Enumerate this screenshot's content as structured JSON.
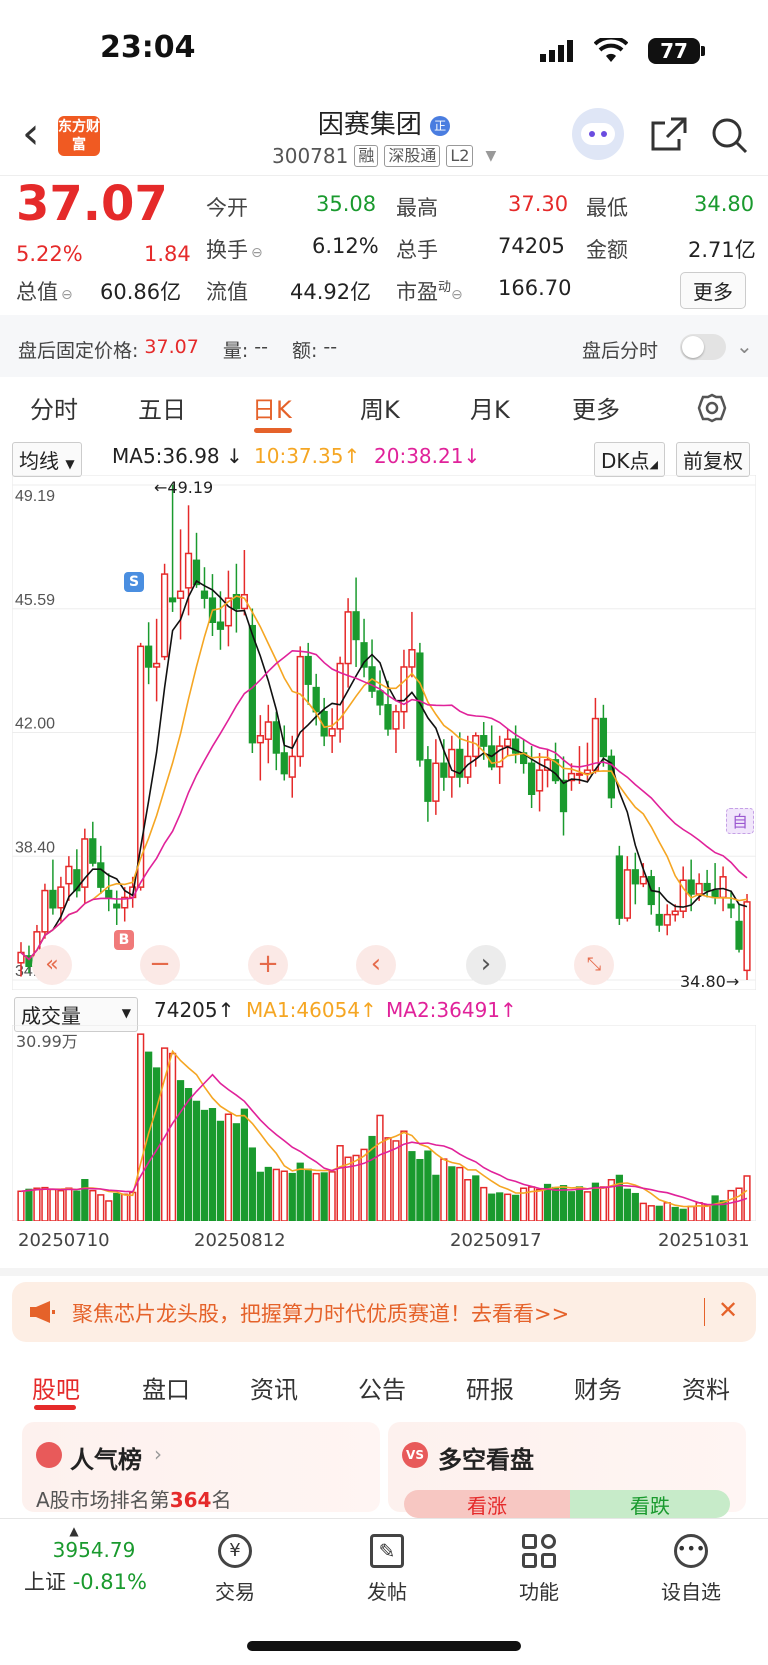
{
  "status": {
    "time": "23:04",
    "battery": "77"
  },
  "header": {
    "logo": "东方财富",
    "stock_name": "因赛集团",
    "code": "300781",
    "tags": [
      "融",
      "深股通",
      "L2"
    ]
  },
  "quote": {
    "price": "37.07",
    "change_pct": "5.22%",
    "change": "1.84",
    "fields": [
      {
        "label": "今开",
        "value": "35.08"
      },
      {
        "label": "最高",
        "value": "37.30"
      },
      {
        "label": "最低",
        "value": "34.80"
      },
      {
        "label": "换手",
        "value": "6.12%"
      },
      {
        "label": "总手",
        "value": "74205"
      },
      {
        "label": "金额",
        "value": "2.71亿"
      },
      {
        "label": "总值",
        "value": "60.86亿"
      },
      {
        "label": "流值",
        "value": "44.92亿"
      },
      {
        "label": "市盈",
        "value": "166.70"
      }
    ],
    "more": "更多"
  },
  "after_hours": {
    "label": "盘后固定价格:",
    "price": "37.07",
    "qty_label": "量:",
    "qty": "--",
    "amt_label": "额:",
    "amt": "--",
    "toggle_label": "盘后分时"
  },
  "period_tabs": [
    "分时",
    "五日",
    "日K",
    "周K",
    "月K",
    "更多"
  ],
  "ma_bar": {
    "selector": "均线",
    "ma5": "MA5:36.98",
    "ma10": "10:37.35",
    "ma20": "20:38.21",
    "dk": "DK点",
    "adjust": "前复权"
  },
  "chart_data": [
    {
      "type": "candlestick",
      "y_ticks": [
        "49.19",
        "45.59",
        "42.00",
        "38.40",
        "34.80"
      ],
      "ylim": [
        34.8,
        49.19
      ],
      "high_label": "49.19",
      "low_label": "34.80",
      "markers": [
        "S",
        "B",
        "自"
      ],
      "x_ticks": [
        "20250710",
        "20250812",
        "20250917",
        "20251031"
      ],
      "series": [
        {
          "name": "MA5",
          "color": "#111111"
        },
        {
          "name": "MA10",
          "color": "#f5a623"
        },
        {
          "name": "MA20",
          "color": "#e0229a"
        }
      ],
      "candles": [
        [
          35.3,
          35.9,
          34.9,
          35.6
        ],
        [
          35.5,
          35.8,
          35.0,
          35.2
        ],
        [
          35.2,
          36.4,
          35.0,
          36.2
        ],
        [
          36.2,
          37.6,
          36.0,
          37.4
        ],
        [
          37.4,
          38.3,
          36.7,
          36.9
        ],
        [
          36.9,
          37.8,
          36.5,
          37.5
        ],
        [
          37.6,
          38.4,
          37.1,
          38.1
        ],
        [
          38.0,
          38.6,
          37.2,
          37.4
        ],
        [
          37.5,
          39.2,
          37.0,
          38.9
        ],
        [
          38.9,
          39.4,
          38.1,
          38.2
        ],
        [
          38.2,
          38.7,
          37.3,
          37.5
        ],
        [
          37.4,
          37.9,
          36.8,
          37.2
        ],
        [
          37.0,
          37.4,
          36.4,
          36.9
        ],
        [
          36.9,
          37.5,
          36.5,
          37.2
        ],
        [
          37.2,
          37.8,
          36.9,
          37.5
        ],
        [
          37.5,
          44.6,
          37.4,
          44.5
        ],
        [
          44.5,
          45.2,
          43.4,
          43.9
        ],
        [
          43.9,
          45.3,
          42.9,
          44.0
        ],
        [
          44.2,
          46.9,
          44.1,
          46.6
        ],
        [
          45.9,
          49.2,
          45.5,
          45.8
        ],
        [
          45.9,
          47.9,
          44.7,
          46.1
        ],
        [
          46.2,
          48.6,
          45.4,
          47.2
        ],
        [
          47.0,
          47.8,
          46.2,
          46.3
        ],
        [
          46.1,
          46.8,
          45.6,
          45.9
        ],
        [
          45.9,
          46.6,
          44.8,
          45.2
        ],
        [
          45.2,
          46.1,
          44.4,
          45.0
        ],
        [
          45.1,
          46.7,
          44.5,
          45.9
        ],
        [
          46.0,
          46.9,
          44.9,
          45.6
        ],
        [
          45.6,
          47.3,
          45.4,
          46.0
        ],
        [
          45.1,
          45.6,
          41.4,
          41.7
        ],
        [
          41.7,
          42.5,
          40.6,
          41.9
        ],
        [
          41.8,
          42.8,
          41.1,
          42.3
        ],
        [
          42.3,
          42.6,
          40.9,
          41.4
        ],
        [
          41.4,
          42.2,
          40.6,
          40.8
        ],
        [
          40.7,
          41.9,
          40.1,
          41.3
        ],
        [
          41.3,
          44.5,
          41.0,
          44.2
        ],
        [
          44.2,
          44.6,
          42.8,
          43.4
        ],
        [
          43.3,
          43.7,
          42.2,
          42.6
        ],
        [
          42.6,
          43.0,
          41.6,
          41.9
        ],
        [
          41.9,
          42.7,
          41.4,
          42.1
        ],
        [
          42.1,
          44.2,
          41.7,
          44.0
        ],
        [
          44.0,
          45.9,
          43.3,
          45.5
        ],
        [
          45.5,
          46.5,
          43.9,
          44.7
        ],
        [
          44.6,
          45.3,
          43.6,
          43.9
        ],
        [
          43.9,
          44.7,
          43.0,
          43.2
        ],
        [
          43.2,
          43.8,
          42.5,
          42.8
        ],
        [
          42.8,
          43.5,
          41.9,
          42.1
        ],
        [
          42.1,
          42.8,
          41.4,
          42.6
        ],
        [
          42.6,
          44.4,
          42.1,
          43.9
        ],
        [
          43.9,
          45.5,
          43.6,
          44.4
        ],
        [
          44.3,
          44.6,
          41.0,
          41.2
        ],
        [
          41.2,
          41.6,
          39.4,
          40.0
        ],
        [
          40.0,
          41.8,
          39.6,
          41.1
        ],
        [
          41.1,
          41.8,
          40.3,
          40.7
        ],
        [
          40.7,
          41.9,
          40.1,
          41.5
        ],
        [
          41.5,
          42.0,
          40.4,
          40.7
        ],
        [
          40.7,
          41.9,
          40.5,
          41.3
        ],
        [
          41.3,
          42.0,
          41.0,
          41.9
        ],
        [
          41.9,
          42.3,
          41.2,
          41.6
        ],
        [
          41.6,
          42.2,
          40.9,
          41.0
        ],
        [
          41.0,
          41.9,
          40.5,
          41.6
        ],
        [
          41.6,
          42.1,
          41.3,
          41.8
        ],
        [
          41.8,
          42.2,
          41.1,
          41.4
        ],
        [
          41.4,
          41.8,
          40.8,
          41.1
        ],
        [
          41.1,
          41.6,
          39.8,
          40.2
        ],
        [
          40.3,
          41.4,
          39.7,
          40.9
        ],
        [
          40.9,
          41.5,
          40.4,
          41.2
        ],
        [
          41.2,
          41.7,
          40.5,
          40.6
        ],
        [
          40.6,
          41.3,
          39.0,
          39.7
        ],
        [
          40.6,
          41.1,
          40.3,
          40.8
        ],
        [
          40.8,
          41.6,
          40.5,
          40.8
        ],
        [
          40.8,
          41.7,
          40.6,
          40.9
        ],
        [
          40.9,
          43.0,
          40.8,
          42.4
        ],
        [
          42.4,
          42.8,
          41.0,
          41.3
        ],
        [
          41.3,
          41.5,
          39.8,
          40.1
        ],
        [
          38.4,
          38.7,
          36.4,
          36.6
        ],
        [
          36.6,
          38.4,
          36.5,
          38.0
        ],
        [
          38.0,
          38.5,
          37.0,
          37.6
        ],
        [
          37.6,
          38.2,
          37.5,
          37.8
        ],
        [
          37.8,
          38.0,
          36.7,
          37.0
        ],
        [
          36.7,
          37.5,
          36.2,
          36.4
        ],
        [
          36.4,
          37.0,
          36.1,
          36.7
        ],
        [
          36.7,
          37.0,
          36.5,
          36.8
        ],
        [
          36.8,
          38.1,
          36.6,
          37.7
        ],
        [
          37.7,
          38.3,
          36.8,
          37.3
        ],
        [
          37.3,
          37.9,
          37.1,
          37.6
        ],
        [
          37.6,
          38.0,
          37.2,
          37.4
        ],
        [
          37.4,
          38.2,
          37.0,
          37.2
        ],
        [
          37.2,
          38.1,
          36.8,
          37.8
        ],
        [
          37.0,
          37.4,
          36.6,
          36.9
        ],
        [
          36.5,
          37.0,
          35.6,
          35.7
        ],
        [
          35.08,
          37.3,
          34.8,
          37.07
        ]
      ]
    },
    {
      "type": "bar",
      "title": "成交量",
      "value_label": "74205",
      "ma1": "MA1:46054",
      "ma2": "MA2:36491",
      "y_top_label": "30.99万",
      "ylim": [
        0,
        309900
      ],
      "series": [
        {
          "name": "MA1",
          "color": "#f5a623"
        },
        {
          "name": "MA2",
          "color": "#e0229a"
        }
      ],
      "values": [
        49000,
        52000,
        54000,
        55000,
        52000,
        50000,
        54000,
        49000,
        68000,
        50000,
        43000,
        33000,
        45000,
        44000,
        47000,
        308000,
        278000,
        252000,
        285000,
        276000,
        231000,
        218000,
        197000,
        182000,
        185000,
        164000,
        176000,
        160000,
        184000,
        120000,
        80000,
        88000,
        85000,
        82000,
        78000,
        95000,
        85000,
        78000,
        79000,
        81000,
        124000,
        105000,
        108000,
        118000,
        139000,
        174000,
        137000,
        132000,
        148000,
        114000,
        101000,
        115000,
        75000,
        102000,
        89000,
        88000,
        68000,
        74000,
        55000,
        44000,
        46000,
        44000,
        42000,
        54000,
        56000,
        52000,
        60000,
        55000,
        58000,
        48000,
        56000,
        48000,
        62000,
        56000,
        68000,
        75000,
        52000,
        45000,
        29000,
        25000,
        24000,
        30000,
        22000,
        19000,
        24000,
        30000,
        26000,
        41000,
        33000,
        50000,
        54000,
        74205
      ],
      "colors": "rgrrrrrggrrrgrrrggrrggggggrgggggrrgggrgrrrrrgrrrrggggrgrrgrggrgrrrgggggrgrrgggrrgrggrrrggrrrr"
    }
  ],
  "banner": {
    "text": "聚焦芯片龙头股，把握算力时代优质赛道！去看看>>"
  },
  "bottom_tabs": [
    "股吧",
    "盘口",
    "资讯",
    "公告",
    "研报",
    "财务",
    "资料"
  ],
  "cards": {
    "popularity": {
      "title": "人气榜",
      "rank_prefix": "A股市场排名第",
      "rank": "364",
      "rank_suffix": "名"
    },
    "sentiment": {
      "title": "多空看盘",
      "up": "看涨",
      "down": "看跌"
    }
  },
  "nav": {
    "index_value": "3954.79",
    "index_name": "上证",
    "index_change": "-0.81%",
    "items": [
      "交易",
      "发帖",
      "功能",
      "设自选"
    ]
  }
}
